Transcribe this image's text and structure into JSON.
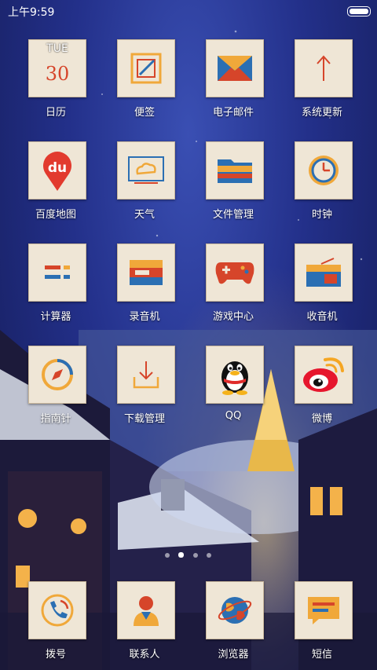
{
  "status": {
    "time": "上午9:59"
  },
  "calendar": {
    "weekday": "TUE",
    "day": "30"
  },
  "apps": [
    {
      "label": "日历",
      "icon": "calendar-icon"
    },
    {
      "label": "便签",
      "icon": "notes-icon"
    },
    {
      "label": "电子邮件",
      "icon": "email-icon"
    },
    {
      "label": "系统更新",
      "icon": "update-arrow-icon"
    },
    {
      "label": "百度地图",
      "icon": "baidu-map-icon"
    },
    {
      "label": "天气",
      "icon": "weather-icon"
    },
    {
      "label": "文件管理",
      "icon": "folder-icon"
    },
    {
      "label": "时钟",
      "icon": "clock-icon"
    },
    {
      "label": "计算器",
      "icon": "calculator-icon"
    },
    {
      "label": "录音机",
      "icon": "recorder-icon"
    },
    {
      "label": "游戏中心",
      "icon": "gamepad-icon"
    },
    {
      "label": "收音机",
      "icon": "radio-icon"
    },
    {
      "label": "指南针",
      "icon": "compass-icon"
    },
    {
      "label": "下载管理",
      "icon": "download-icon"
    },
    {
      "label": "QQ",
      "icon": "qq-penguin-icon"
    },
    {
      "label": "微博",
      "icon": "weibo-icon"
    }
  ],
  "dock": [
    {
      "label": "拨号",
      "icon": "phone-icon"
    },
    {
      "label": "联系人",
      "icon": "contacts-icon"
    },
    {
      "label": "浏览器",
      "icon": "browser-globe-icon"
    },
    {
      "label": "短信",
      "icon": "sms-icon"
    }
  ],
  "pager": {
    "pages": 4,
    "active_index": 1
  },
  "colors": {
    "tile_bg": "#efe6d6",
    "accent_red": "#d6452a",
    "accent_orange": "#f0a83a",
    "accent_blue": "#2b6fb3"
  }
}
